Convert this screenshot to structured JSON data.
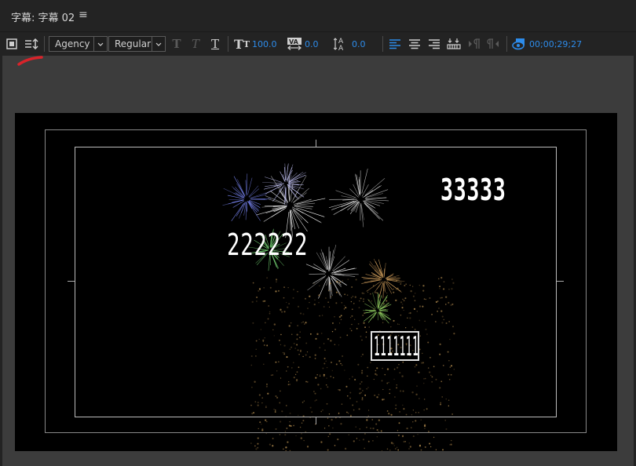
{
  "panel": {
    "title": "字幕: 字幕 02",
    "menu_icon": "hamburger-menu-icon"
  },
  "toolbar": {
    "font_family": "Agency ...",
    "font_style": "Regular",
    "font_size": "100.0",
    "kerning": "0.0",
    "baseline": "0.0",
    "timecode": "00;00;29;27",
    "accent_color": "#2d8ceb"
  },
  "canvas": {
    "texts": [
      "222222",
      "33333",
      "1111111"
    ],
    "background_color": "#000000",
    "safe_margin_color": "#bbbbbb"
  }
}
